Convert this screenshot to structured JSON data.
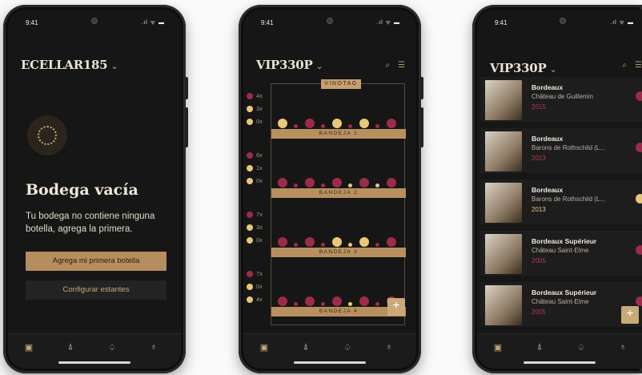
{
  "colors": {
    "accent": "#c9a87a",
    "wine_red": "#9c2b4a",
    "white_wine": "#e8c878",
    "background": "#161616"
  },
  "status": {
    "time": "9:41",
    "icons": ".ıl ᯤ ▬"
  },
  "phone1": {
    "title": "ECELLAR185",
    "empty_title": "Bodega vacía",
    "empty_text": "Tu bodega no contiene ninguna botella, agrega la primera.",
    "primary_button": "Agrega mi primera botella",
    "secondary_button": "Configurar estantes"
  },
  "phone2": {
    "title": "VIP330P",
    "rack_label": "VINOTAG",
    "trays": [
      "BANDEJA 1",
      "BANDEJA 2",
      "BANDEJA 3",
      "BANDEJA 4"
    ],
    "counts": [
      [
        "4x",
        "3x",
        "0x"
      ],
      [
        "6x",
        "1x",
        "0x"
      ],
      [
        "7x",
        "3x",
        "0x"
      ],
      [
        "7x",
        "0x",
        "4x"
      ]
    ],
    "add_label": "+"
  },
  "phone3": {
    "title": "VIP330P",
    "add_label": "+",
    "wines": [
      {
        "region": "Bordeaux",
        "name": "Château de Guillemin",
        "year": "2015",
        "type": "red"
      },
      {
        "region": "Bordeaux",
        "name": "Barons de Rothschild (L...",
        "year": "2013",
        "type": "red"
      },
      {
        "region": "Bordeaux",
        "name": "Barons de Rothschild (L...",
        "year": "2013",
        "type": "white"
      },
      {
        "region": "Bordeaux Supérieur",
        "name": "Château Saint-Elme",
        "year": "2005",
        "type": "red"
      },
      {
        "region": "Bordeaux Supérieur",
        "name": "Château Saint-Elme",
        "year": "2005",
        "type": "red"
      }
    ]
  },
  "nav_icons": [
    "cellar-icon",
    "bottle-icon",
    "bell-icon",
    "profile-icon"
  ]
}
